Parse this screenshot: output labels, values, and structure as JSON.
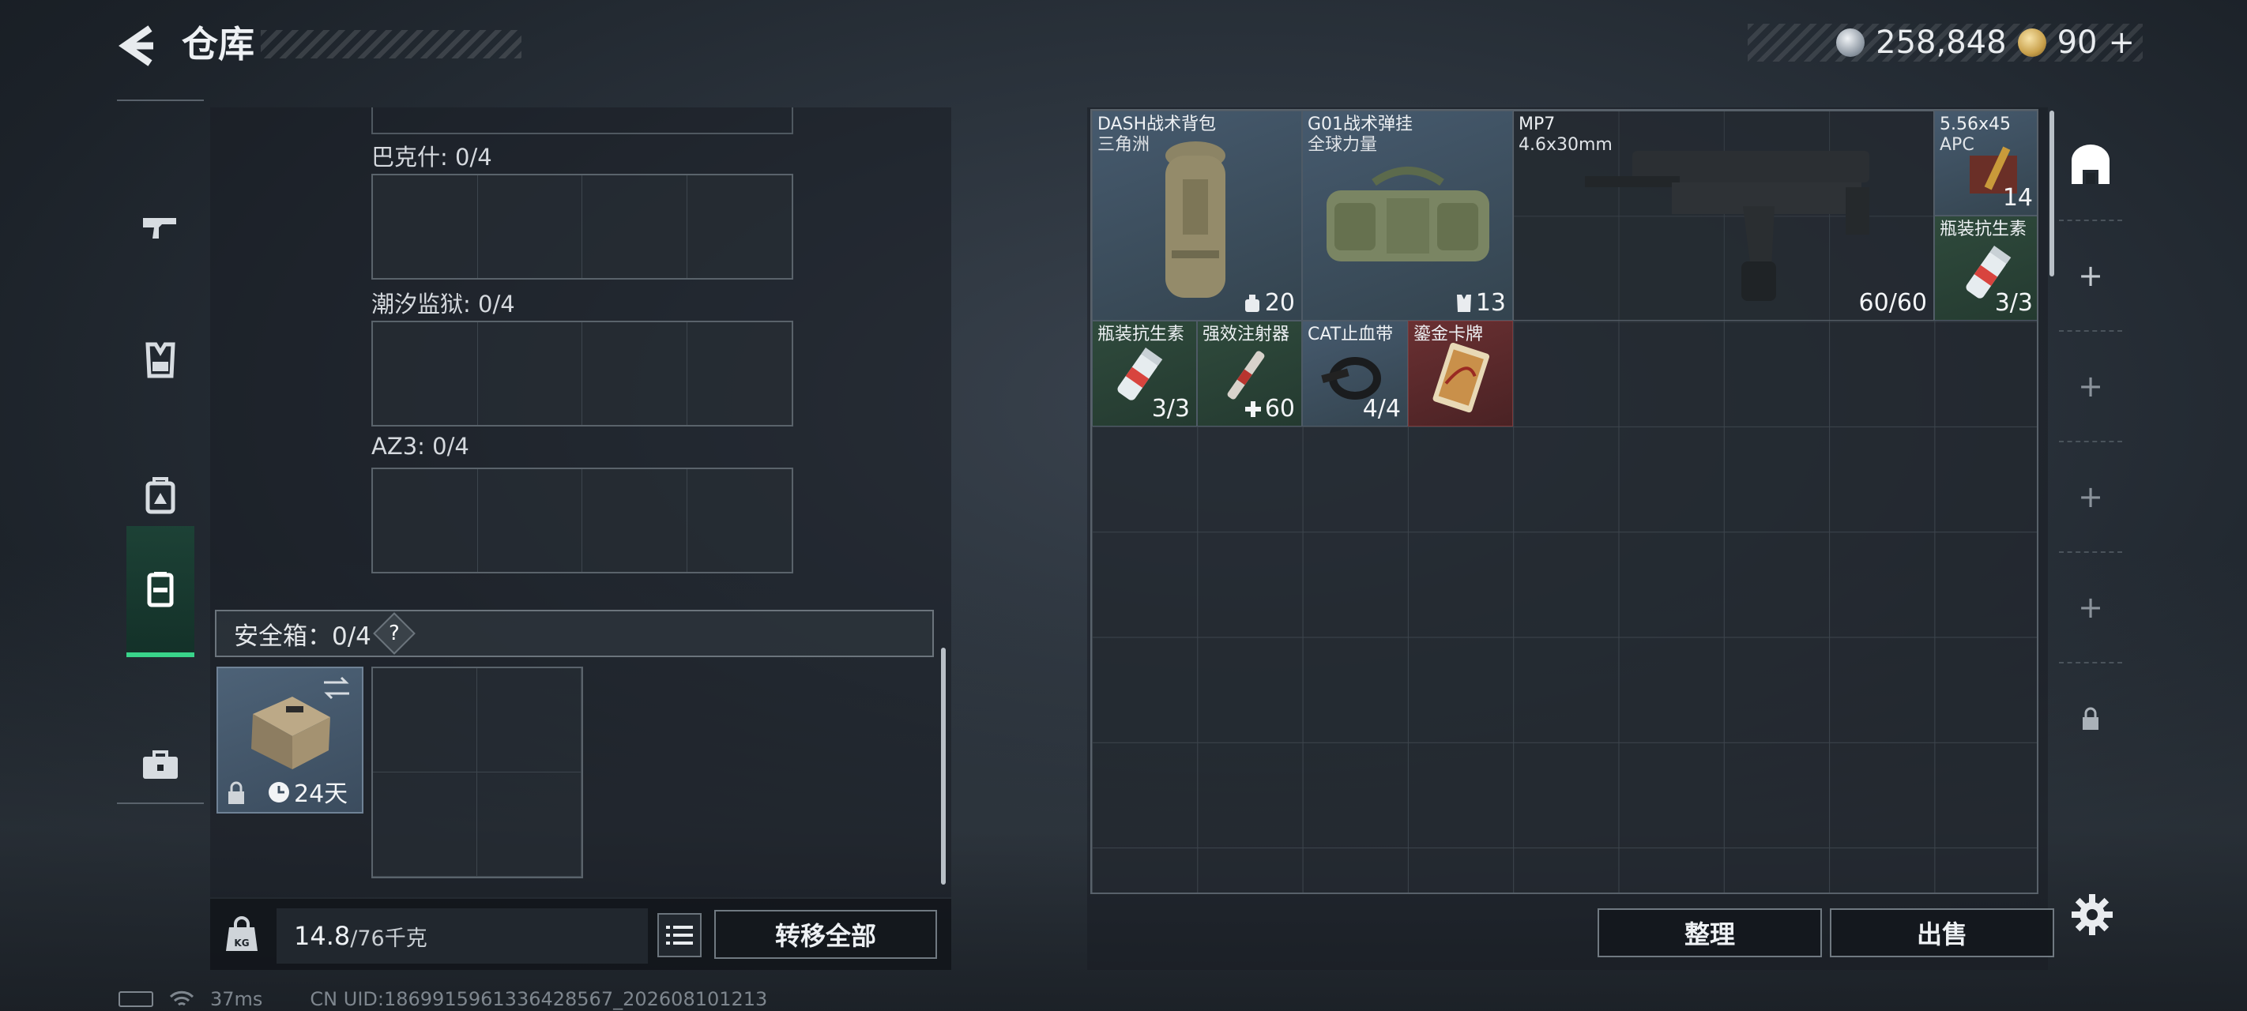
{
  "header": {
    "title": "仓库",
    "silver_amount": "258,848",
    "gold_amount": "90",
    "gold_suffix": "+"
  },
  "left_nav": {
    "items": [
      {
        "icon": "gun-icon"
      },
      {
        "icon": "vest-icon"
      },
      {
        "icon": "backpack-icon"
      },
      {
        "icon": "safe-box-icon",
        "active": true
      },
      {
        "icon": "toolbox-icon"
      }
    ]
  },
  "left_panel": {
    "slots": [
      {
        "label": "巴克什: 0/4"
      },
      {
        "label": "潮汐监狱: 0/4"
      },
      {
        "label": "AZ3: 0/4"
      }
    ],
    "safe_box": {
      "label": "安全箱：0/4",
      "help": "?",
      "duration": "24天"
    }
  },
  "footer": {
    "weight_current": "14.8",
    "weight_max": "/76千克",
    "transfer_all": "转移全部",
    "sort": "整理",
    "sell": "出售"
  },
  "status": {
    "ping": "37ms",
    "uid": "CN UID:1869915961336428567_202608101213"
  },
  "stash": {
    "items": [
      {
        "name": "DASH战术背包",
        "subtitle": "三角洲",
        "count": "20",
        "count_icon": "backpack-small-icon"
      },
      {
        "name": "G01战术弹挂",
        "subtitle": "全球力量",
        "count": "13",
        "count_icon": "vest-small-icon"
      },
      {
        "name": "MP7",
        "subtitle": "4.6x30mm",
        "count": "60/60"
      },
      {
        "name": "5.56x45",
        "subtitle": "APC",
        "count": "14"
      },
      {
        "name": "瓶装抗生素",
        "subtitle": "",
        "count": "3/3"
      },
      {
        "name": "瓶装抗生素",
        "subtitle": "",
        "count": "3/3"
      },
      {
        "name": "强效注射器",
        "subtitle": "",
        "count": "60",
        "count_icon": "plus-icon"
      },
      {
        "name": "CAT止血带",
        "subtitle": "",
        "count": "4/4"
      },
      {
        "name": "鎏金卡牌",
        "subtitle": "",
        "count": ""
      }
    ]
  },
  "colors": {
    "accent_green": "#39d48a",
    "item_blue": "#3b4c5e",
    "item_green": "#2f4a3c",
    "item_red": "#5a2a2c"
  }
}
